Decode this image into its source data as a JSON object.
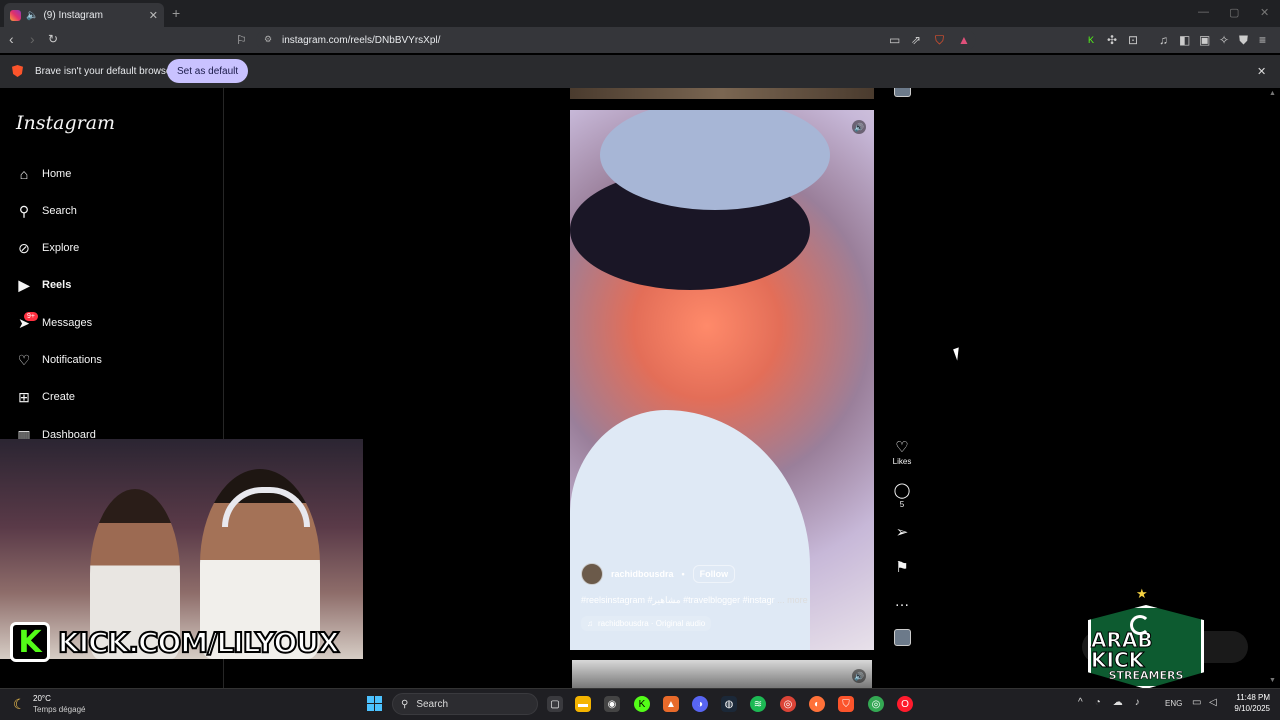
{
  "browser": {
    "tab_title": "(9) Instagram",
    "tab_close": "✕",
    "new_tab": "+",
    "url": "instagram.com/reels/DNbBVYrsXpl/",
    "notification_text": "Brave isn't your default browser",
    "set_default_label": "Set as default",
    "notification_close": "✕"
  },
  "instagram": {
    "logo": "Instagram",
    "nav": {
      "home": "Home",
      "search": "Search",
      "explore": "Explore",
      "reels": "Reels",
      "messages": "Messages",
      "messages_badge": "9+",
      "notifications": "Notifications",
      "create": "Create",
      "dashboard": "Dashboard"
    },
    "reel": {
      "author": "rachidbousdra",
      "separator": "•",
      "follow_label": "Follow",
      "caption": "#reelsinstagram #مشاهير #travelblogger #instagr",
      "caption_more": "... more",
      "audio": "rachidbousdra · Original audio"
    },
    "actions": {
      "likes_label": "Likes",
      "comments_count": "5"
    }
  },
  "overlay": {
    "kick_letter": "K",
    "kick_url": "KICK.COM/LILYOUX",
    "arab_kick_line1": "ARAB KICK",
    "arab_kick_line2": "STREAMERS"
  },
  "taskbar": {
    "weather_temp": "20°C",
    "weather_desc": "Temps dégagé",
    "search_label": "Search",
    "lang": "ENG",
    "time": "11:48 PM",
    "date": "9/10/2025"
  }
}
